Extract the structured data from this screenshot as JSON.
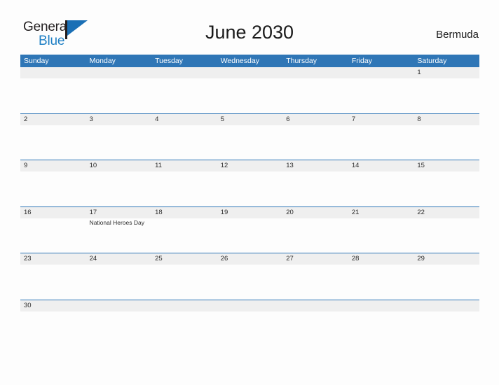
{
  "brand": {
    "name_part1": "General",
    "name_part2": "Blue",
    "flag_icon": "flag-triangle-icon",
    "color_primary": "#1e7fc4",
    "color_text": "#231f20"
  },
  "header": {
    "month_title": "June 2030",
    "country": "Bermuda"
  },
  "calendar": {
    "header_bg": "#2f76b6",
    "date_band_bg": "#efefef",
    "row_divider_color": "#2f76b6",
    "weekdays": [
      "Sunday",
      "Monday",
      "Tuesday",
      "Wednesday",
      "Thursday",
      "Friday",
      "Saturday"
    ],
    "weeks": [
      [
        {
          "day": "",
          "events": []
        },
        {
          "day": "",
          "events": []
        },
        {
          "day": "",
          "events": []
        },
        {
          "day": "",
          "events": []
        },
        {
          "day": "",
          "events": []
        },
        {
          "day": "",
          "events": []
        },
        {
          "day": "1",
          "events": []
        }
      ],
      [
        {
          "day": "2",
          "events": []
        },
        {
          "day": "3",
          "events": []
        },
        {
          "day": "4",
          "events": []
        },
        {
          "day": "5",
          "events": []
        },
        {
          "day": "6",
          "events": []
        },
        {
          "day": "7",
          "events": []
        },
        {
          "day": "8",
          "events": []
        }
      ],
      [
        {
          "day": "9",
          "events": []
        },
        {
          "day": "10",
          "events": []
        },
        {
          "day": "11",
          "events": []
        },
        {
          "day": "12",
          "events": []
        },
        {
          "day": "13",
          "events": []
        },
        {
          "day": "14",
          "events": []
        },
        {
          "day": "15",
          "events": []
        }
      ],
      [
        {
          "day": "16",
          "events": []
        },
        {
          "day": "17",
          "events": [
            "National Heroes Day"
          ]
        },
        {
          "day": "18",
          "events": []
        },
        {
          "day": "19",
          "events": []
        },
        {
          "day": "20",
          "events": []
        },
        {
          "day": "21",
          "events": []
        },
        {
          "day": "22",
          "events": []
        }
      ],
      [
        {
          "day": "23",
          "events": []
        },
        {
          "day": "24",
          "events": []
        },
        {
          "day": "25",
          "events": []
        },
        {
          "day": "26",
          "events": []
        },
        {
          "day": "27",
          "events": []
        },
        {
          "day": "28",
          "events": []
        },
        {
          "day": "29",
          "events": []
        }
      ],
      [
        {
          "day": "30",
          "events": []
        },
        {
          "day": "",
          "events": []
        },
        {
          "day": "",
          "events": []
        },
        {
          "day": "",
          "events": []
        },
        {
          "day": "",
          "events": []
        },
        {
          "day": "",
          "events": []
        },
        {
          "day": "",
          "events": []
        }
      ]
    ]
  }
}
